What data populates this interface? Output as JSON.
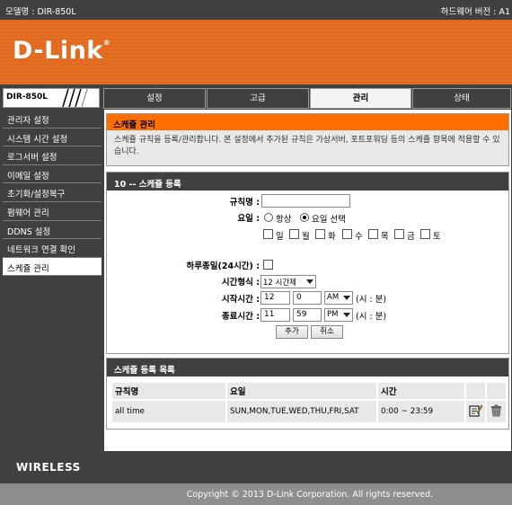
{
  "topbar": {
    "model": "모델명 : DIR-850L",
    "hw": "하드웨어 버전 : A1"
  },
  "brand": {
    "logo": "D-Link",
    "reg": "®",
    "model_tab": "DIR-850L"
  },
  "tabs": [
    {
      "label": "설정"
    },
    {
      "label": "고급"
    },
    {
      "label": "관리"
    },
    {
      "label": "상태"
    }
  ],
  "sidebar": {
    "items": [
      {
        "label": "관리자 설정"
      },
      {
        "label": "시스템 시간 설정"
      },
      {
        "label": "로그서버 설정"
      },
      {
        "label": "이메일 설정"
      },
      {
        "label": "초기화/설정복구"
      },
      {
        "label": "펌웨어 관리"
      },
      {
        "label": "DDNS 설정"
      },
      {
        "label": "네트워크 연결 확인"
      },
      {
        "label": "스케쥴 관리"
      }
    ]
  },
  "intro": {
    "title": "스케쥴 관리",
    "desc": "스케쥴 규칙을 등록/관리합니다. 본 설정에서 추가된 규칙은 가상서버, 포트포워딩 등의 스케쥴 항목에 적용할 수 있습니다."
  },
  "register": {
    "title": "10 -- 스케쥴 등록",
    "rule_name_label": "규칙명 :",
    "rule_name_value": "",
    "day_label": "요일 :",
    "radio_always": "항상",
    "radio_select": "요일 선택",
    "days": [
      "일",
      "월",
      "화",
      "수",
      "목",
      "금",
      "토"
    ],
    "allday_label": "하루종일(24시간) :",
    "timeformat_label": "시간형식 :",
    "timeformat_value": "12 시간제",
    "start_label": "시작시간 :",
    "start_hour": "12",
    "start_min": "0",
    "start_ampm": "AM",
    "end_label": "종료시간 :",
    "end_hour": "11",
    "end_min": "59",
    "end_ampm": "PM",
    "hm_unit": "(시 : 분)",
    "add_button": "추가",
    "cancel_button": "취소"
  },
  "list": {
    "title": "스케쥴 등록 목록",
    "headers": [
      "규칙명",
      "요일",
      "시간"
    ],
    "rows": [
      {
        "name": "all time",
        "days": "SUN,MON,TUE,WED,THU,FRI,SAT",
        "time": "0:00 ~ 23:59"
      }
    ]
  },
  "footer": {
    "wireless": "WIRELESS",
    "copyright": "Copyright © 2013 D-Link Corporation. All rights reserved."
  }
}
